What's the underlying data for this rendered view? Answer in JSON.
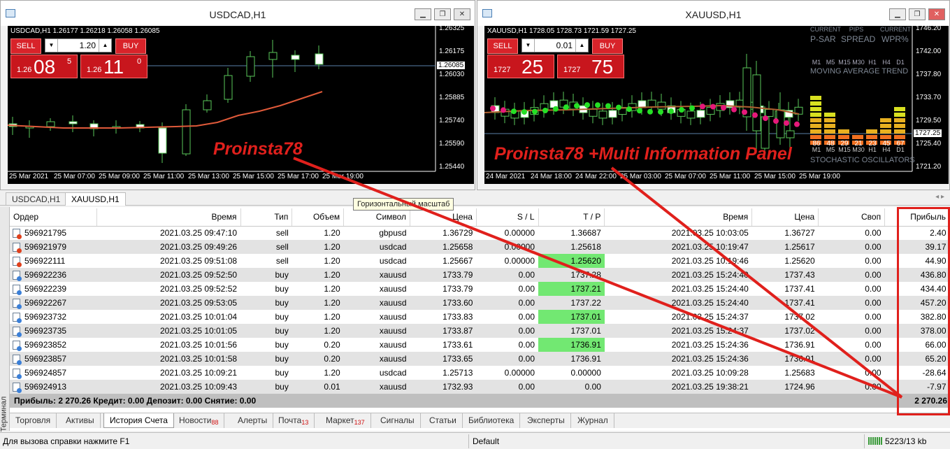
{
  "usdcad": {
    "title": "USDCAD,H1",
    "info": "USDCAD,H1  1.26177 1.26218 1.26058 1.26085",
    "sell_label": "SELL",
    "buy_label": "BUY",
    "lot": "1.20",
    "bid_small": "1.26",
    "bid_big": "08",
    "bid_sup": "5",
    "ask_small": "1.26",
    "ask_big": "11",
    "ask_sup": "0",
    "price_ticks": [
      "1.26325",
      "1.26175",
      "1.26030",
      "1.25885",
      "1.25740",
      "1.25590",
      "1.25440"
    ],
    "current_price": "1.26085",
    "time_ticks": [
      "25 Mar 2021",
      "25 Mar 07:00",
      "25 Mar 09:00",
      "25 Mar 11:00",
      "25 Mar 13:00",
      "25 Mar 15:00",
      "25 Mar 17:00",
      "25 Mar 19:00"
    ]
  },
  "xauusd": {
    "title": "XAUUSD,H1",
    "info": "XAUUSD,H1  1728.05 1728.73 1721.59 1727.25",
    "sell_label": "SELL",
    "buy_label": "BUY",
    "lot": "0.01",
    "bid_small": "1727",
    "bid_big": "25",
    "ask_small": "1727",
    "ask_big": "75",
    "price_ticks": [
      "1746.20",
      "1742.00",
      "1737.80",
      "1733.70",
      "1729.50",
      "1725.40",
      "1721.20"
    ],
    "current_price": "1727.25",
    "time_ticks": [
      "24 Mar 2021",
      "24 Mar 18:00",
      "24 Mar 22:00",
      "25 Mar 03:00",
      "25 Mar 07:00",
      "25 Mar 11:00",
      "25 Mar 15:00",
      "25 Mar 19:00"
    ],
    "panel": {
      "hdr": [
        "CURRENT",
        "PIPS",
        "CURRENT"
      ],
      "names": [
        "P-SAR",
        "SPREAD",
        "WPR%"
      ],
      "tfs": [
        "M1",
        "M5",
        "M15",
        "M30",
        "H1",
        "H4",
        "D1"
      ],
      "ma_trend": "MOVING AVERAGE TREND",
      "osc_values": [
        "86",
        "48",
        "29",
        "21",
        "23",
        "45",
        "67"
      ],
      "osc_label": "STOCHASTIC OSCILLATORS"
    }
  },
  "overlay": {
    "text1": "Proinsta78",
    "text2": "Proinsta78 +Multi Information Panel"
  },
  "chart_tabs": [
    "USDCAD,H1",
    "XAUUSD,H1"
  ],
  "tooltip": "Горизонтальный масштаб",
  "columns": [
    "Ордер",
    "Время",
    "Тип",
    "Объем",
    "Символ",
    "Цена",
    "S / L",
    "T / P",
    "Время",
    "Цена",
    "Своп",
    "Прибыль"
  ],
  "rows": [
    [
      "596921795",
      "2021.03.25 09:47:10",
      "sell",
      "1.20",
      "gbpusd",
      "1.36729",
      "0.00000",
      "1.36687",
      "2021.03.25 10:03:05",
      "1.36727",
      "0.00",
      "2.40"
    ],
    [
      "596921979",
      "2021.03.25 09:49:26",
      "sell",
      "1.20",
      "usdcad",
      "1.25658",
      "0.00000",
      "1.25618",
      "2021.03.25 10:19:47",
      "1.25617",
      "0.00",
      "39.17"
    ],
    [
      "596922111",
      "2021.03.25 09:51:08",
      "sell",
      "1.20",
      "usdcad",
      "1.25667",
      "0.00000",
      "1.25620",
      "2021.03.25 10:19:46",
      "1.25620",
      "0.00",
      "44.90"
    ],
    [
      "596922236",
      "2021.03.25 09:52:50",
      "buy",
      "1.20",
      "xauusd",
      "1733.79",
      "0.00",
      "1737.28",
      "2021.03.25 15:24:40",
      "1737.43",
      "0.00",
      "436.80"
    ],
    [
      "596922239",
      "2021.03.25 09:52:52",
      "buy",
      "1.20",
      "xauusd",
      "1733.79",
      "0.00",
      "1737.21",
      "2021.03.25 15:24:40",
      "1737.41",
      "0.00",
      "434.40"
    ],
    [
      "596922267",
      "2021.03.25 09:53:05",
      "buy",
      "1.20",
      "xauusd",
      "1733.60",
      "0.00",
      "1737.22",
      "2021.03.25 15:24:40",
      "1737.41",
      "0.00",
      "457.20"
    ],
    [
      "596923732",
      "2021.03.25 10:01:04",
      "buy",
      "1.20",
      "xauusd",
      "1733.83",
      "0.00",
      "1737.01",
      "2021.03.25 15:24:37",
      "1737.02",
      "0.00",
      "382.80"
    ],
    [
      "596923735",
      "2021.03.25 10:01:05",
      "buy",
      "1.20",
      "xauusd",
      "1733.87",
      "0.00",
      "1737.01",
      "2021.03.25 15:24:37",
      "1737.02",
      "0.00",
      "378.00"
    ],
    [
      "596923852",
      "2021.03.25 10:01:56",
      "buy",
      "0.20",
      "xauusd",
      "1733.61",
      "0.00",
      "1736.91",
      "2021.03.25 15:24:36",
      "1736.91",
      "0.00",
      "66.00"
    ],
    [
      "596923857",
      "2021.03.25 10:01:58",
      "buy",
      "0.20",
      "xauusd",
      "1733.65",
      "0.00",
      "1736.91",
      "2021.03.25 15:24:36",
      "1736.91",
      "0.00",
      "65.20"
    ],
    [
      "596924857",
      "2021.03.25 10:09:21",
      "buy",
      "1.20",
      "usdcad",
      "1.25713",
      "0.00000",
      "0.00000",
      "2021.03.25 10:09:28",
      "1.25683",
      "0.00",
      "-28.64"
    ],
    [
      "596924913",
      "2021.03.25 10:09:43",
      "buy",
      "0.01",
      "xauusd",
      "1732.93",
      "0.00",
      "0.00",
      "2021.03.25 19:38:21",
      "1724.96",
      "0.00",
      "-7.97"
    ]
  ],
  "summary": {
    "left": "Прибыль: 2 270.26  Кредит: 0.00  Депозит: 0.00  Снятие: 0.00",
    "right": "2 270.26"
  },
  "terminal_label": "Терминал",
  "bottom_tabs": [
    {
      "label": "Торговля",
      "badge": ""
    },
    {
      "label": "Активы",
      "badge": ""
    },
    {
      "label": "История Счета",
      "badge": ""
    },
    {
      "label": "Новости",
      "badge": "88"
    },
    {
      "label": "Алерты",
      "badge": ""
    },
    {
      "label": "Почта",
      "badge": "13"
    },
    {
      "label": "Маркет",
      "badge": "137"
    },
    {
      "label": "Сигналы",
      "badge": ""
    },
    {
      "label": "Статьи",
      "badge": ""
    },
    {
      "label": "Библиотека",
      "badge": ""
    },
    {
      "label": "Эксперты",
      "badge": ""
    },
    {
      "label": "Журнал",
      "badge": ""
    }
  ],
  "status": {
    "help": "Для вызова справки нажмите F1",
    "profile": "Default",
    "traffic": "5223/13 kb"
  },
  "colors": {
    "tp_green": "#72e872",
    "sell_red": "#d8232a",
    "annotation_red": "#e0201c",
    "chart_bg": "#000000"
  }
}
